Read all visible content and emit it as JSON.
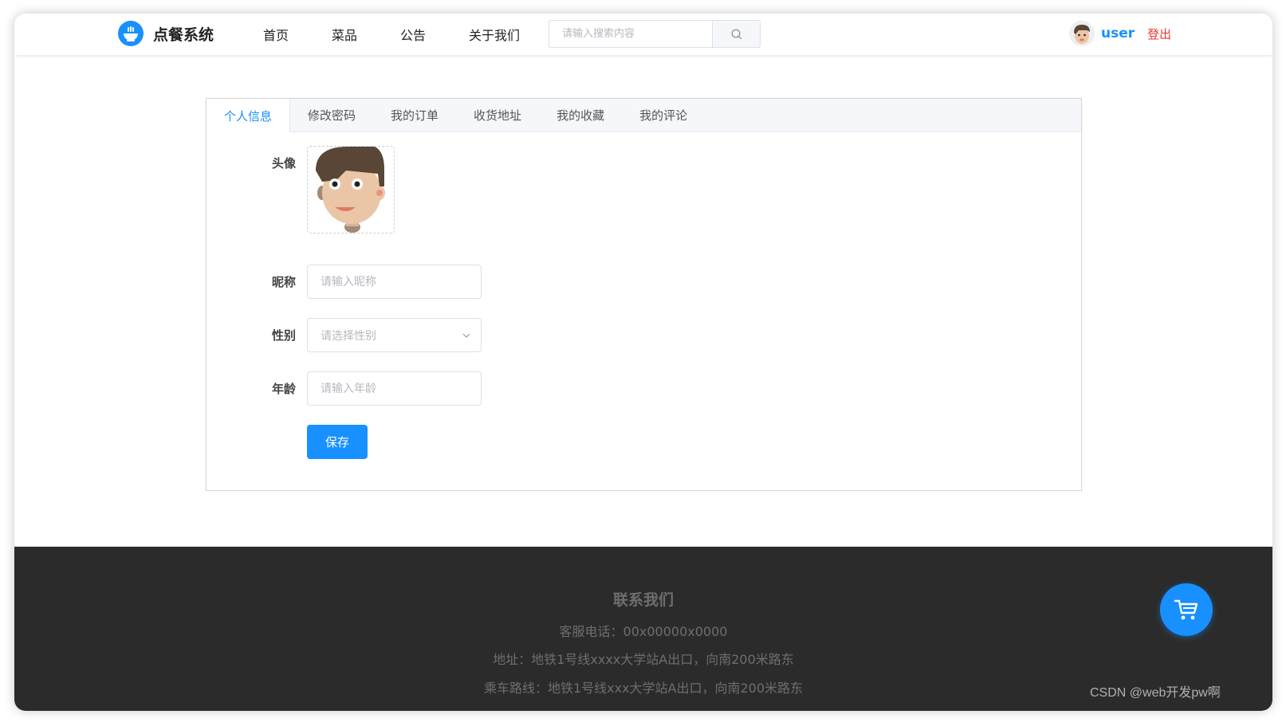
{
  "header": {
    "logo_text": "点餐系统",
    "nav": [
      "首页",
      "菜品",
      "公告",
      "关于我们"
    ],
    "search_placeholder": "请输入搜索内容",
    "username": "user",
    "logout": "登出"
  },
  "tabs": [
    {
      "label": "个人信息",
      "active": true
    },
    {
      "label": "修改密码",
      "active": false
    },
    {
      "label": "我的订单",
      "active": false
    },
    {
      "label": "收货地址",
      "active": false
    },
    {
      "label": "我的收藏",
      "active": false
    },
    {
      "label": "我的评论",
      "active": false
    }
  ],
  "form": {
    "avatar_label": "头像",
    "nickname_label": "昵称",
    "nickname_placeholder": "请输入昵称",
    "gender_label": "性别",
    "gender_placeholder": "请选择性别",
    "age_label": "年龄",
    "age_placeholder": "请输入年龄",
    "save_label": "保存"
  },
  "footer": {
    "title": "联系我们",
    "phone": "客服电话：00x00000x0000",
    "address": "地址：地铁1号线xxxx大学站A出口，向南200米路东",
    "route": "乘车路线：地铁1号线xxx大学站A出口，向南200米路东"
  },
  "watermark": "CSDN @web开发pw啊",
  "colors": {
    "accent": "#1890ff",
    "logout": "#e53935",
    "footer_bg": "#2b2b2b"
  },
  "icons": {
    "logo": "bowl-logo-icon",
    "search": "search-icon",
    "select_arrow": "chevron-down-icon",
    "cart": "shopping-cart-icon"
  }
}
